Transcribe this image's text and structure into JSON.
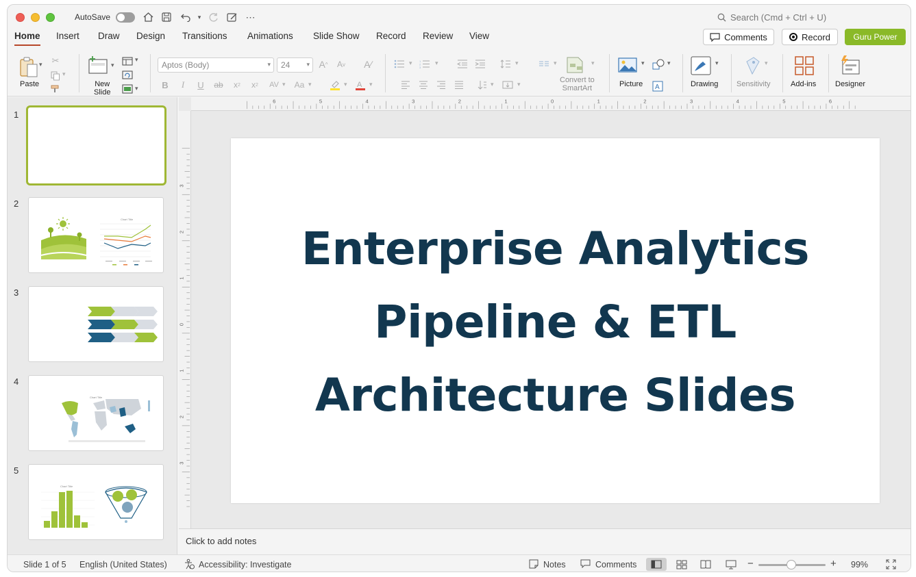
{
  "titlebar": {
    "autosave_label": "AutoSave",
    "search_placeholder": "Search (Cmd + Ctrl + U)"
  },
  "tabs": [
    "Home",
    "Insert",
    "Draw",
    "Design",
    "Transitions",
    "Animations",
    "Slide Show",
    "Record",
    "Review",
    "View"
  ],
  "header_buttons": {
    "comments": "Comments",
    "record": "Record",
    "guru": "Guru Power"
  },
  "ribbon": {
    "paste": "Paste",
    "new_slide_line1": "New",
    "new_slide_line2": "Slide",
    "font_name": "Aptos (Body)",
    "font_size": "24",
    "convert_line1": "Convert to",
    "convert_line2": "SmartArt",
    "picture": "Picture",
    "drawing": "Drawing",
    "sensitivity": "Sensitivity",
    "addins": "Add-ins",
    "designer": "Designer"
  },
  "thumbnails": [
    {
      "number": "1"
    },
    {
      "number": "2"
    },
    {
      "number": "3"
    },
    {
      "number": "4"
    },
    {
      "number": "5"
    }
  ],
  "slide": {
    "title_line1": "Enterprise Analytics",
    "title_line2": "Pipeline & ETL",
    "title_line3": "Architecture Slides",
    "title_color": "#12374f"
  },
  "rulers": {
    "horizontal": [
      "6",
      "5",
      "4",
      "3",
      "2",
      "1",
      "0",
      "1",
      "2",
      "3",
      "4",
      "5",
      "6"
    ],
    "vertical": [
      "3",
      "2",
      "1",
      "0",
      "1",
      "2",
      "3"
    ]
  },
  "notes_placeholder": "Click to add notes",
  "status": {
    "slide_counter": "Slide 1 of 5",
    "language": "English (United States)",
    "accessibility": "Accessibility: Investigate",
    "notes": "Notes",
    "comments": "Comments",
    "zoom": "99%"
  },
  "colors": {
    "accent_green": "#8ab928",
    "accent_navy": "#1f5f85",
    "tab_underline": "#b7472a"
  }
}
